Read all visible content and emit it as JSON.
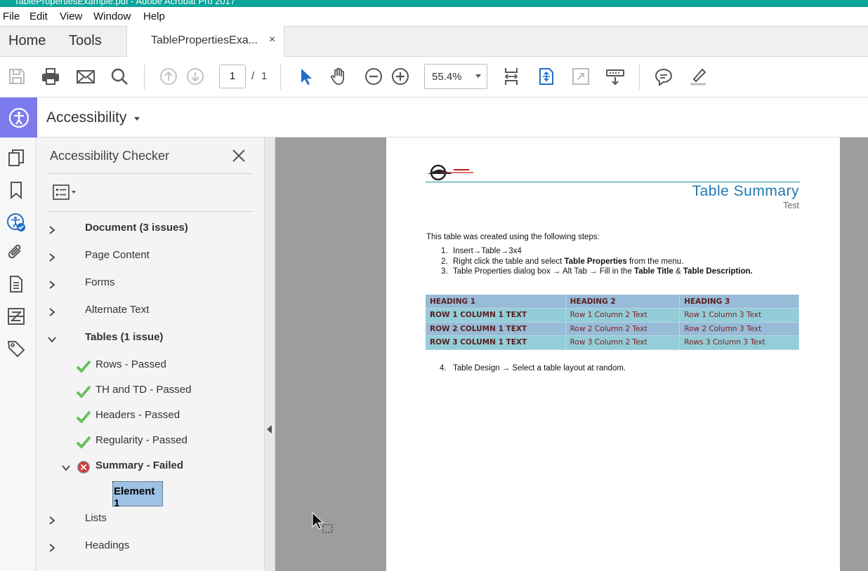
{
  "window": {
    "title": "TablePropertiesExample.pdf - Adobe Acrobat Pro 2017"
  },
  "menu": [
    "File",
    "Edit",
    "View",
    "Window",
    "Help"
  ],
  "tabs": {
    "home": "Home",
    "tools": "Tools",
    "document": "TablePropertiesExa...",
    "close": "×"
  },
  "toolbar": {
    "page_current": "1",
    "page_sep": "/",
    "page_total": "1",
    "zoom": "55.4%"
  },
  "accessibility": {
    "title": "Accessibility"
  },
  "panel": {
    "title": "Accessibility Checker",
    "items": [
      {
        "label": "Document (3 issues)"
      },
      {
        "label": "Page Content"
      },
      {
        "label": "Forms"
      },
      {
        "label": "Alternate Text"
      },
      {
        "label": "Tables (1 issue)"
      },
      {
        "label": "Rows - Passed"
      },
      {
        "label": "TH and TD - Passed"
      },
      {
        "label": "Headers - Passed"
      },
      {
        "label": "Regularity - Passed"
      },
      {
        "label": "Summary - Failed"
      },
      {
        "label": "Element 1"
      },
      {
        "label": "Lists"
      },
      {
        "label": "Headings"
      }
    ]
  },
  "document": {
    "title": "Table Summary",
    "subtitle": "Test",
    "intro": "This table was created using the following steps:",
    "steps": [
      {
        "num": "1.",
        "pre": "Insert→Table→3x4",
        "b1": "",
        "mid": "",
        "b2": "",
        "post": ""
      },
      {
        "num": "2.",
        "pre": "Right click the table and select ",
        "b1": "Table Properties",
        "mid": " from the menu.",
        "b2": "",
        "post": ""
      },
      {
        "num": "3.",
        "pre": "Table Properties dialog box → Alt Tab → Fill in the ",
        "b1": "Table Title",
        "mid": " & ",
        "b2": "Table Description.",
        "post": ""
      }
    ],
    "step4": {
      "num": "4.",
      "text": "Table Design → Select a table layout at random."
    },
    "table": {
      "headers": [
        "HEADING 1",
        "HEADING 2",
        "HEADING 3"
      ],
      "rows": [
        [
          "ROW 1 COLUMN 1 TEXT",
          "Row 1 Column 2 Text",
          "Row 1 Column 3 Text"
        ],
        [
          "ROW 2 COLUMN 1 TEXT",
          "Row 2 Column 2 Text",
          "Row 2 Column 3 Text"
        ],
        [
          "ROW 3 COLUMN 1 TEXT",
          "Row 3 Column 2 Text",
          "Rows 3 Column 3 Text"
        ]
      ]
    }
  },
  "icons": {
    "toolbar": [
      "save-icon",
      "print-icon",
      "email-icon",
      "search-icon",
      "prev-page-icon",
      "next-page-icon",
      "select-tool-icon",
      "hand-tool-icon",
      "zoom-out-icon",
      "zoom-in-icon",
      "fit-page-icon",
      "rotate-icon",
      "full-screen-icon",
      "read-mode-icon",
      "comment-icon",
      "highlight-icon"
    ],
    "rail": [
      "pages-icon",
      "bookmark-icon",
      "accessibility-check-icon",
      "attachment-icon",
      "document-icon",
      "compare-icon",
      "tags-icon"
    ]
  },
  "colors": {
    "accent": "#7b7bed",
    "titlebar": "#0aa59a",
    "link_blue": "#1f78b4",
    "fail_red": "#d43a3a",
    "pass_green": "#3aa53a"
  }
}
